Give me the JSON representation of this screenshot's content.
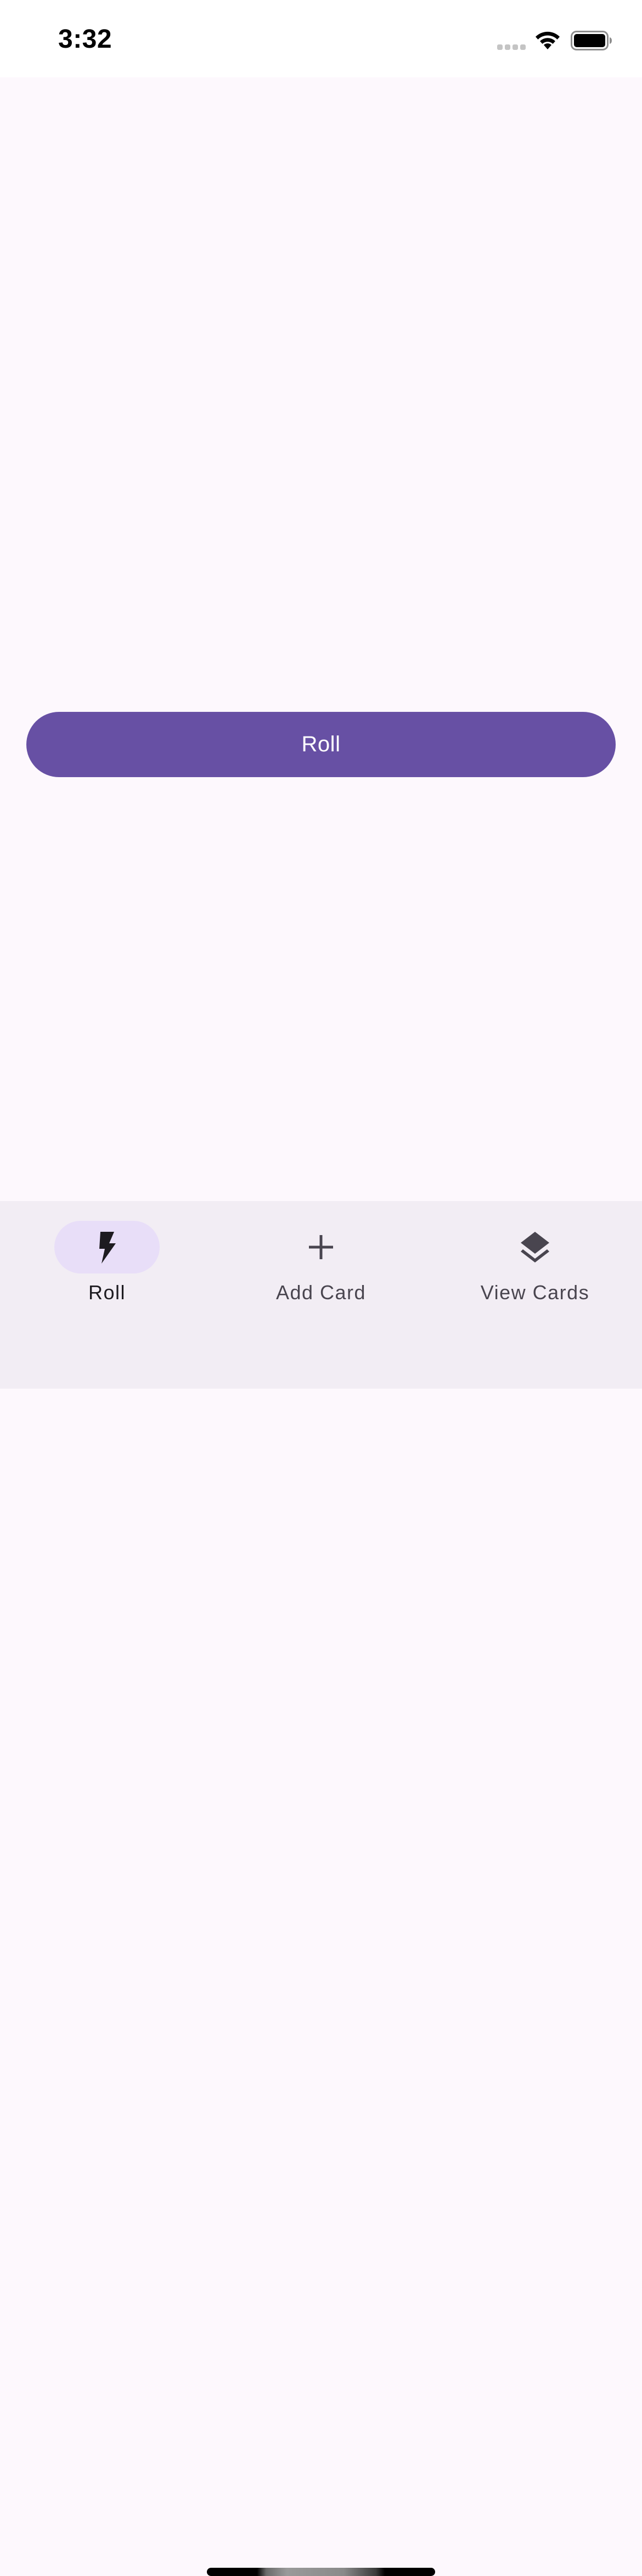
{
  "status_bar": {
    "time": "3:32"
  },
  "main": {
    "roll_button_label": "Roll"
  },
  "nav": {
    "items": [
      {
        "label": "Roll",
        "icon": "bolt-icon",
        "active": true
      },
      {
        "label": "Add Card",
        "icon": "plus-icon",
        "active": false
      },
      {
        "label": "View Cards",
        "icon": "layers-icon",
        "active": false
      }
    ]
  },
  "colors": {
    "primary": "#6750a4",
    "background": "#fdf8fd",
    "nav_background": "#f2edf4",
    "nav_indicator": "#e8def8"
  }
}
